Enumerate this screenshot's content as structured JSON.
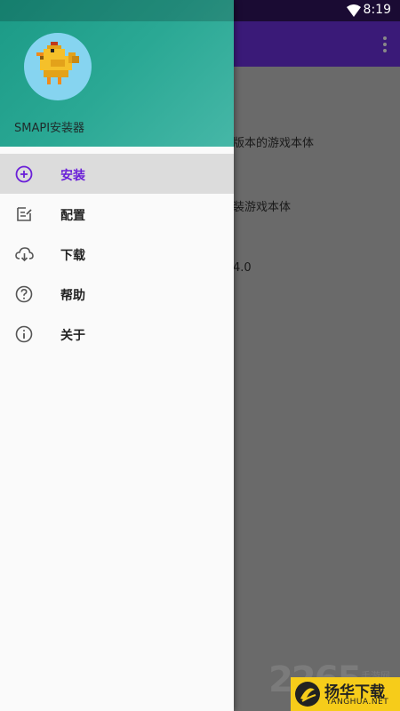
{
  "status_bar": {
    "time": "8:19"
  },
  "background": {
    "lines": [
      "版本的游戏本体",
      "装游戏本体",
      "4.0"
    ]
  },
  "drawer": {
    "header": {
      "title": "SMAPI安装器"
    },
    "menu": [
      {
        "label": "安装",
        "icon": "add-circle-icon",
        "active": true
      },
      {
        "label": "配置",
        "icon": "edit-note-icon",
        "active": false
      },
      {
        "label": "下载",
        "icon": "cloud-download-icon",
        "active": false
      },
      {
        "label": "帮助",
        "icon": "help-circle-icon",
        "active": false
      },
      {
        "label": "关于",
        "icon": "info-circle-icon",
        "active": false
      }
    ]
  },
  "watermark": {
    "number": "2265",
    "small": "手游网",
    "brand_cn": "扬华下载",
    "brand_en": "YANGHUA.NET"
  },
  "colors": {
    "accent": "#6a1fd8",
    "header_gradient_start": "#1b9a86",
    "header_gradient_end": "#46b7a7",
    "appbar": "#3a1a78",
    "watermark_badge": "#f6cc1a"
  }
}
